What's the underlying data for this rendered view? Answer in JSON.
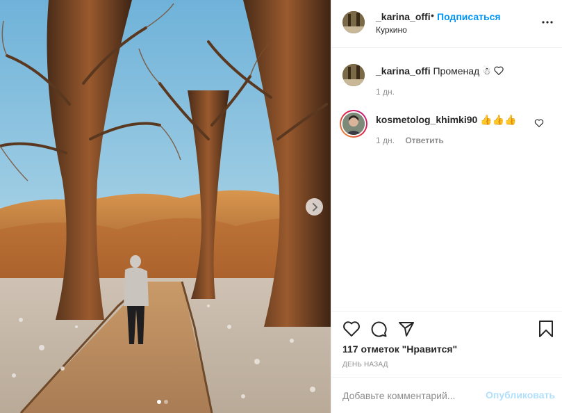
{
  "header": {
    "username": "_karina_offi",
    "separator": "•",
    "follow_label": "Подписаться",
    "location": "Куркино",
    "more_icon": "more-horizontal-icon"
  },
  "caption": {
    "username": "_karina_offi",
    "text": "Променад",
    "emoji": "☃",
    "time": "1 дн."
  },
  "comments": [
    {
      "username": "kosmetolog_khimki90",
      "text": "👍👍👍",
      "time": "1 дн.",
      "reply_label": "Ответить",
      "like_icon": "heart-outline-icon"
    }
  ],
  "actions": {
    "like_icon": "heart-outline-icon",
    "comment_icon": "comment-bubble-icon",
    "share_icon": "paper-plane-icon",
    "save_icon": "bookmark-icon"
  },
  "likes_text": "117 отметок \"Нравится\"",
  "time_ago": "ДЕНЬ НАЗАД",
  "add_comment": {
    "placeholder": "Добавьте комментарий...",
    "publish_label": "Опубликовать"
  },
  "carousel": {
    "slide_count": 2,
    "active_index": 0
  },
  "colors": {
    "link_blue": "#0095f6",
    "publish_disabled": "#b2dffc",
    "text": "#262626",
    "muted": "#8e8e8e",
    "border": "#efefef"
  }
}
